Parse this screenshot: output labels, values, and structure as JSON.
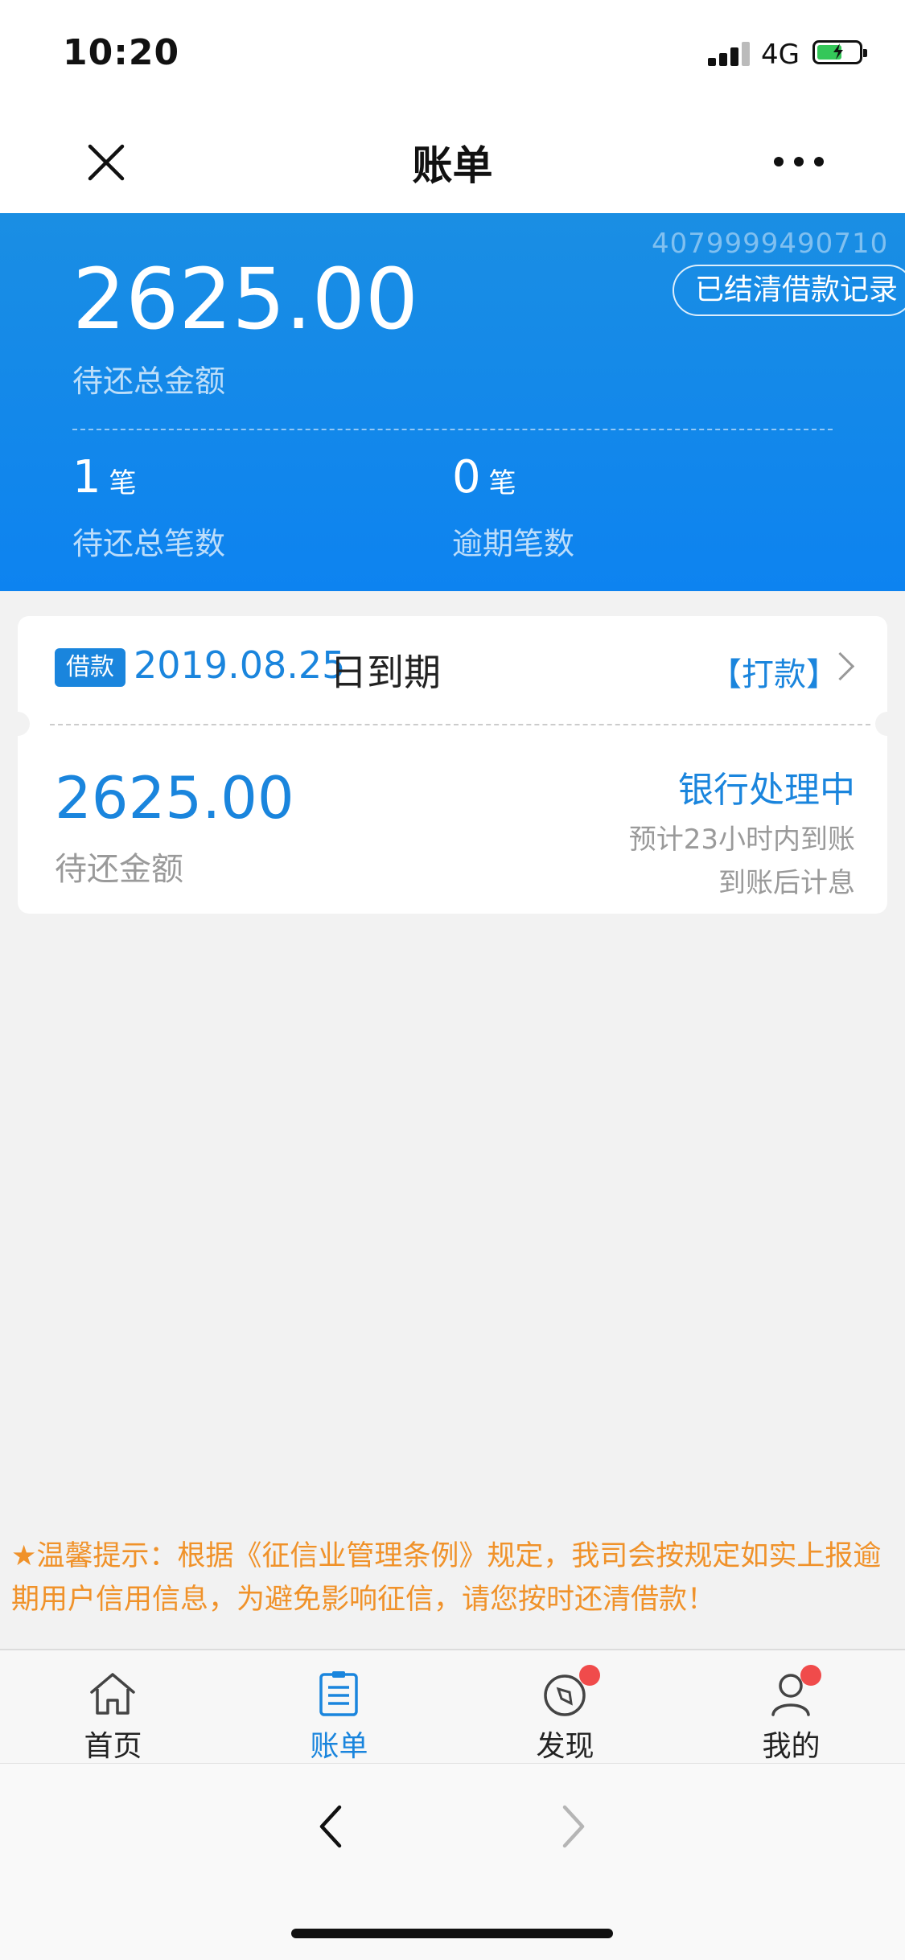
{
  "status_bar": {
    "time": "10:20",
    "network": "4G"
  },
  "nav": {
    "title": "账单"
  },
  "summary": {
    "account_no": "4079999490710",
    "cleared_records_label": "已结清借款记录",
    "total_amount": "2625.00",
    "total_amount_label": "待还总金额",
    "pending_count": "1",
    "pending_count_unit": "笔",
    "pending_count_label": "待还总笔数",
    "overdue_count": "0",
    "overdue_count_unit": "笔",
    "overdue_count_label": "逾期笔数"
  },
  "loan_card": {
    "tag": "借款",
    "due_date": "2019.08.25",
    "due_suffix": "日到期",
    "pay_link": "【打款】",
    "amount": "2625.00",
    "amount_label": "待还金额",
    "status": "银行处理中",
    "eta": "预计23小时内到账",
    "interest_note": "到账后计息"
  },
  "tip": {
    "text": "★温馨提示：根据《征信业管理条例》规定，我司会按规定如实上报逾期用户信用信息，为避免影响征信，请您按时还清借款！"
  },
  "tabs": [
    {
      "label": "首页",
      "icon": "home-icon",
      "active": false
    },
    {
      "label": "账单",
      "icon": "bill-icon",
      "active": true
    },
    {
      "label": "发现",
      "icon": "compass-icon",
      "active": false,
      "badge": true
    },
    {
      "label": "我的",
      "icon": "user-icon",
      "active": false,
      "badge": true
    }
  ],
  "colors": {
    "primary": "#1a85dd",
    "hero": "#0d83f0",
    "tip": "#f0922a",
    "badge": "#f04b4b"
  }
}
